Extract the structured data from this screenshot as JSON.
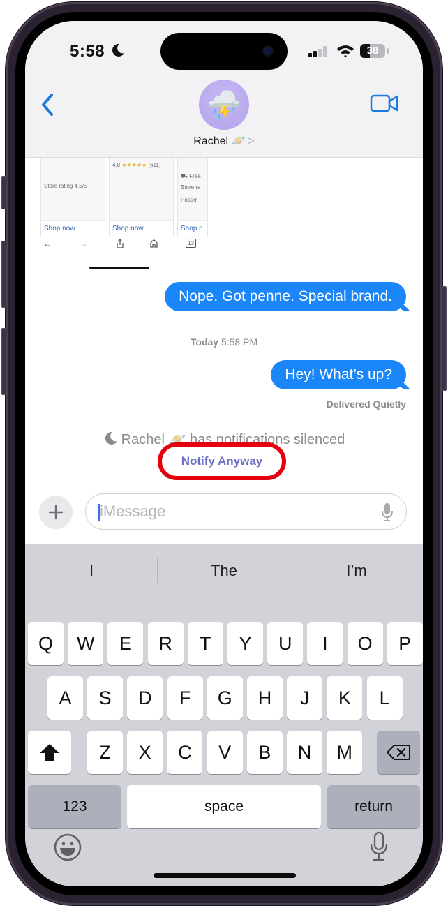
{
  "status_bar": {
    "time": "5:58",
    "focus_icon": "moon-icon",
    "signal_bars_active": 2,
    "signal_bars_total": 4,
    "battery_percent": "38"
  },
  "header": {
    "back_icon": "chevron-left-icon",
    "contact_avatar_emoji": "⛈️",
    "contact_name": "Rachel 🪐",
    "contact_chevron": ">",
    "video_icon": "video-camera-icon"
  },
  "link_preview": {
    "cards": [
      {
        "line1": "Store rating 4.5/5",
        "shop": "Shop now"
      },
      {
        "rating": "4.8",
        "stars": "★★★★★",
        "count": "(611)",
        "shop": "Shop now"
      },
      {
        "line1": "Free",
        "line2": "Store ra",
        "line3": "Poster",
        "shop": "Shop n"
      }
    ],
    "browser_bar": {
      "back": "←",
      "forward": "→",
      "share_icon": "share-icon",
      "home_icon": "home-icon",
      "tabs_count": "13"
    }
  },
  "messages": [
    {
      "text": "Nope. Got penne. Special brand.",
      "sender": "me"
    },
    {
      "text": "Hey! What’s up?",
      "sender": "me"
    }
  ],
  "timestamp": {
    "day": "Today",
    "time": "5:58 PM"
  },
  "delivery_status": "Delivered Quietly",
  "focus_notice": {
    "text_name": "Rachel 🪐",
    "text_rest": "has notifications silenced",
    "action_label": "Notify Anyway",
    "highlight_color": "#e5000f",
    "action_color": "#6b70c7"
  },
  "composer": {
    "plus_icon": "plus-icon",
    "placeholder": "iMessage",
    "mic_icon": "microphone-icon"
  },
  "keyboard": {
    "suggestions": [
      "I",
      "The",
      "I’m"
    ],
    "row1": [
      "Q",
      "W",
      "E",
      "R",
      "T",
      "Y",
      "U",
      "I",
      "O",
      "P"
    ],
    "row2": [
      "A",
      "S",
      "D",
      "F",
      "G",
      "H",
      "J",
      "K",
      "L"
    ],
    "row3": [
      "Z",
      "X",
      "C",
      "V",
      "B",
      "N",
      "M"
    ],
    "numbers_label": "123",
    "space_label": "space",
    "return_label": "return",
    "shift_icon": "shift-icon",
    "delete_icon": "delete-backspace-icon",
    "emoji_icon": "emoji-icon",
    "dictation_icon": "microphone-icon"
  },
  "colors": {
    "bubble_blue": "#1a86f7",
    "ios_blue": "#1a7be0",
    "keyboard_bg": "#d1d3d9"
  }
}
